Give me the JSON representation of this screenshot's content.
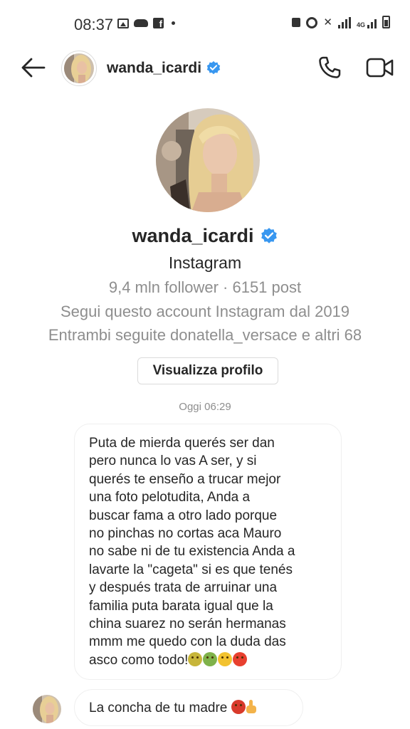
{
  "status_bar": {
    "time": "08:37",
    "network_label": "4G",
    "left_icons": [
      "gallery-icon",
      "cloud-icon",
      "facebook-icon",
      "dot-icon"
    ],
    "right_icons": [
      "lock-icon",
      "alarm-icon",
      "mute-icon",
      "signal-icon",
      "4g-signal-icon",
      "battery-icon"
    ]
  },
  "header": {
    "username": "wanda_icardi",
    "verified": true,
    "back_icon": "arrow-left-icon",
    "call_icon": "phone-icon",
    "video_icon": "video-camera-icon"
  },
  "profile": {
    "name": "wanda_icardi",
    "platform": "Instagram",
    "stats": "9,4 mln follower · 6151 post",
    "since": "Segui questo account Instagram dal 2019",
    "mutual": "Entrambi seguite donatella_versace e altri 68",
    "view_profile_label": "Visualizza profilo"
  },
  "conversation": {
    "timestamp": "Oggi 06:29",
    "messages": [
      {
        "text": "Puta de mierda querés ser dan\npero nunca lo vas A ser, y si\nquerés te enseño a trucar mejor\nuna foto pelotudita, Anda a\nbuscar fama a otro lado porque\nno pinchas no cortas aca Mauro\nno sabe ni de tu existencia Anda a\nlavarte la \"cageta\" si es que tenés\ny después trata de arruinar una\nfamilia puta barata igual que la\nchina suarez no serán hermanas\nmmm me quedo con la duda das\nasco como todo!",
        "emojis": [
          "nauseated-face",
          "vomiting-face",
          "unamused-face",
          "angry-face"
        ]
      },
      {
        "text": "La concha de tu madre",
        "emojis": [
          "cursing-face",
          "middle-finger"
        ]
      }
    ]
  },
  "colors": {
    "verified_blue": "#3897f0",
    "secondary_text": "#8e8e8e",
    "primary_text": "#262626",
    "border": "#dbdbdb"
  }
}
